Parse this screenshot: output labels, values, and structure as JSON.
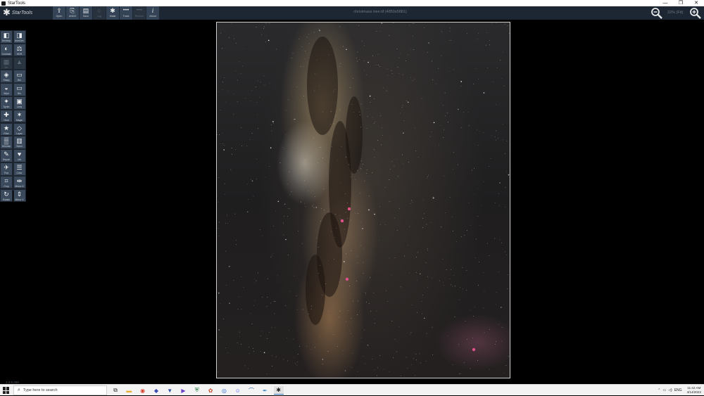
{
  "window": {
    "title": "StarTools",
    "controls": [
      "—",
      "❐",
      "✕"
    ]
  },
  "app": {
    "logo_text": "StarTools"
  },
  "toolbar": {
    "buttons": [
      {
        "id": "open",
        "label": "Open",
        "icon": "open-icon",
        "glyph": "⇪"
      },
      {
        "id": "undo",
        "label": "UNDO",
        "icon": "undo-icon",
        "glyph": "⎘"
      },
      {
        "id": "save",
        "label": "Save",
        "icon": "save-icon",
        "glyph": "▤"
      },
      {
        "id": "log",
        "label": "Log",
        "icon": "circle-icon",
        "glyph": "○",
        "disabled": true
      },
      {
        "id": "mask",
        "label": "Mask",
        "icon": "star-mask-icon",
        "glyph": "✱"
      },
      {
        "id": "track",
        "label": "Track",
        "icon": "track-icon",
        "glyph": "••••"
      },
      {
        "id": "restore",
        "label": "Restore",
        "icon": "restore-icon",
        "glyph": "••••",
        "disabled": true
      },
      {
        "id": "about",
        "label": "About",
        "icon": "info-icon",
        "glyph": "i"
      }
    ],
    "document_title": "christmass tree.tif (4850x5881)",
    "zoom_level": "22% (Fit)"
  },
  "modules": [
    {
      "label": "Develop",
      "icon": "develop-icon",
      "glyph": "◧"
    },
    {
      "label": "AutoDev",
      "icon": "autodev-icon",
      "glyph": "◨"
    },
    {
      "label": "Contrast",
      "icon": "contrast-icon",
      "glyph": "◐"
    },
    {
      "label": "HDR",
      "icon": "hdr-icon",
      "glyph": "⚖"
    },
    {
      "label": "Bin",
      "icon": "bin-icon",
      "glyph": "▦",
      "disabled": true
    },
    {
      "label": "",
      "icon": "disabled-icon",
      "glyph": "▲",
      "disabled": true
    },
    {
      "label": "Sharp",
      "icon": "sharp-icon",
      "glyph": "◈"
    },
    {
      "label": "Bin",
      "icon": "bin-icon-2",
      "glyph": "▭"
    },
    {
      "label": "Wipe",
      "icon": "wipe-icon",
      "glyph": "◒"
    },
    {
      "label": "Bin",
      "icon": "bin-icon-3",
      "glyph": "▭"
    },
    {
      "label": "Synth",
      "icon": "synth-icon",
      "glyph": "✦"
    },
    {
      "label": "Lens",
      "icon": "lens-icon",
      "glyph": "▣"
    },
    {
      "label": "Heal",
      "icon": "heal-icon",
      "glyph": "✚"
    },
    {
      "label": "Magic",
      "icon": "magic-icon",
      "glyph": "✶"
    },
    {
      "label": "Filter",
      "icon": "filter-icon",
      "glyph": "★"
    },
    {
      "label": "Layer",
      "icon": "layer-icon",
      "glyph": "◇"
    },
    {
      "label": "Denoise",
      "icon": "denoise-icon",
      "glyph": "▒"
    },
    {
      "label": "Band",
      "icon": "band-icon",
      "glyph": "▥"
    },
    {
      "label": "Repair",
      "icon": "repair-icon",
      "glyph": "✎"
    },
    {
      "label": "Life",
      "icon": "heart-icon",
      "glyph": "♥"
    },
    {
      "label": "Flux",
      "icon": "flux-icon",
      "glyph": "✈"
    },
    {
      "label": "Color",
      "icon": "color-icon",
      "glyph": "☰"
    },
    {
      "label": "Crop",
      "icon": "crop-icon",
      "glyph": "⌗"
    },
    {
      "label": "Mirror H",
      "icon": "mirror-h-icon",
      "glyph": "⇹"
    },
    {
      "label": "Rotate",
      "icon": "rotate-icon",
      "glyph": "↻"
    },
    {
      "label": "Mirror V",
      "icon": "mirror-v-icon",
      "glyph": "⇕"
    }
  ],
  "version": "1.3.5.289",
  "taskbar": {
    "search_placeholder": "Type here to search",
    "apps": [
      {
        "name": "task-view-icon",
        "glyph": "⧉",
        "color": "#333333"
      },
      {
        "name": "file-explorer-icon",
        "glyph": "▬",
        "color": "#e8b23a"
      },
      {
        "name": "chrome-icon",
        "glyph": "◉",
        "color": "#d9412f"
      },
      {
        "name": "app-v-icon",
        "glyph": "◆",
        "color": "#3b4bb0"
      },
      {
        "name": "app-shield-icon",
        "glyph": "▼",
        "color": "#3552a8"
      },
      {
        "name": "media-player-icon",
        "glyph": "▶",
        "color": "#6a43c6"
      },
      {
        "name": "security-icon",
        "glyph": "⛨",
        "color": "#1f7a3b"
      },
      {
        "name": "paint-icon",
        "glyph": "✿",
        "color": "#c24b2a"
      },
      {
        "name": "app-globe-icon",
        "glyph": "◎",
        "color": "#2e6ccf"
      },
      {
        "name": "discord-icon",
        "glyph": "☺",
        "color": "#5865f2"
      },
      {
        "name": "app-arc-icon",
        "glyph": "⌒",
        "color": "#336699"
      },
      {
        "name": "app-feather-icon",
        "glyph": "✒",
        "color": "#4a8bbf"
      },
      {
        "name": "startools-icon",
        "glyph": "✱",
        "color": "#222222",
        "active": true
      }
    ],
    "tray": {
      "chevron": "⌃",
      "network": "▭",
      "volume": "◁)",
      "lang": "ENG",
      "time": "11:42 AM",
      "date": "4/14/2022"
    }
  }
}
